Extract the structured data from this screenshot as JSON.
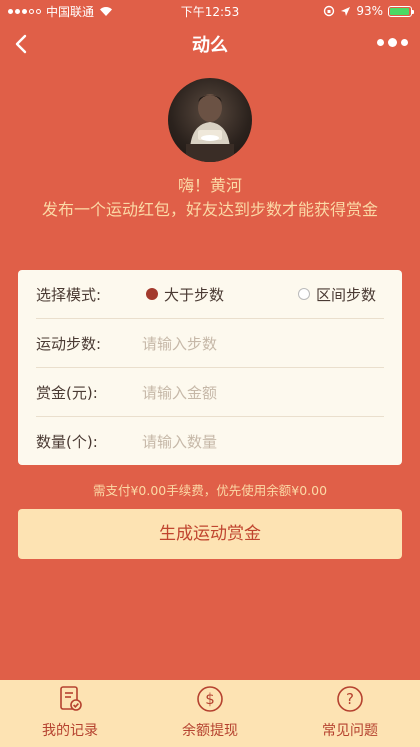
{
  "status_bar": {
    "carrier": "中国联通",
    "time": "下午12:53",
    "battery": "93%",
    "battery_level": 0.93
  },
  "nav": {
    "title": "动么",
    "back_icon": "chevron-left-icon",
    "more_icon": "more-dots-icon"
  },
  "profile": {
    "greeting": "嗨！黄河",
    "description": "发布一个运动红包，好友达到步数才能获得赏金"
  },
  "form": {
    "mode": {
      "label": "选择模式:",
      "options": [
        "大于步数",
        "区间步数"
      ],
      "selected": "大于步数"
    },
    "steps": {
      "label": "运动步数:",
      "placeholder": "请输入步数"
    },
    "reward": {
      "label": "赏金(元):",
      "placeholder": "请输入金额"
    },
    "count": {
      "label": "数量(个):",
      "placeholder": "请输入数量"
    }
  },
  "fee_note": "需支付¥0.00手续费，优先使用余额¥0.00",
  "submit_label": "生成运动赏金",
  "tabs": [
    {
      "label": "我的记录",
      "icon": "record-icon"
    },
    {
      "label": "余额提现",
      "icon": "withdraw-icon"
    },
    {
      "label": "常见问题",
      "icon": "question-icon"
    }
  ],
  "colors": {
    "background": "#e05f48",
    "accent_text": "#fbd9a6",
    "button_bg": "#fde3b3",
    "button_text": "#c0452f",
    "radio_selected": "#a33a2d"
  }
}
